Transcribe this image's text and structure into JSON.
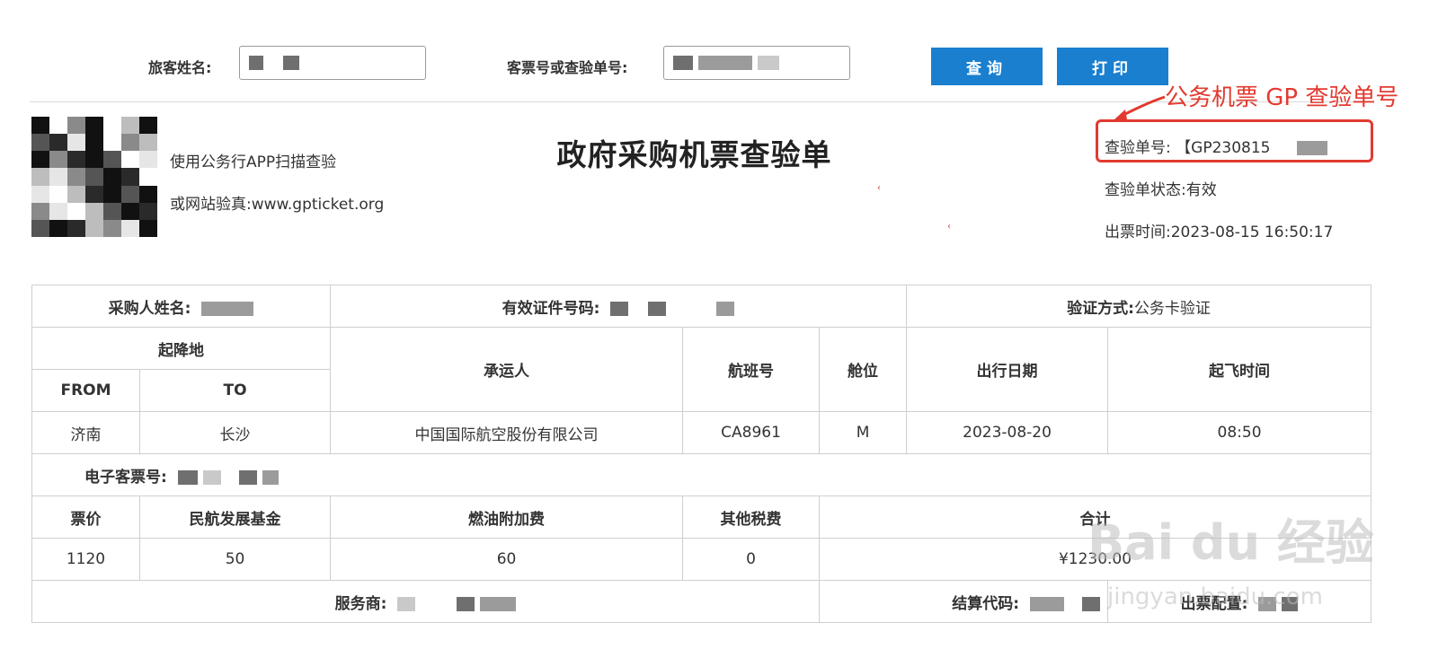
{
  "search": {
    "passenger_name_label": "旅客姓名:",
    "ticket_no_label": "客票号或查验单号:",
    "query_button": "查询",
    "print_button": "打印"
  },
  "header": {
    "scan_hint": "使用公务行APP扫描查验",
    "web_hint": "或网站验真:www.gpticket.org",
    "title": "政府采购机票查验单",
    "check_no_label": "查验单号:",
    "check_no_value": "【GP230815",
    "status_label": "查验单状态:",
    "status_value": "有效",
    "issue_time_label": "出票时间:",
    "issue_time_value": "2023-08-15 16:50:17",
    "annotation": "公务机票 GP 查验单号"
  },
  "table": {
    "purchaser_label": "采购人姓名:",
    "id_label": "有效证件号码:",
    "verify_label": "验证方式:",
    "verify_value": "公务卡验证",
    "route_header": "起降地",
    "from_header": "FROM",
    "to_header": "TO",
    "carrier_header": "承运人",
    "flight_header": "航班号",
    "cabin_header": "舱位",
    "date_header": "出行日期",
    "time_header": "起飞时间",
    "from_value": "济南",
    "to_value": "长沙",
    "carrier_value": "中国国际航空股份有限公司",
    "flight_value": "CA8961",
    "cabin_value": "M",
    "date_value": "2023-08-20",
    "time_value": "08:50",
    "eticket_label": "电子客票号:",
    "price_header": "票价",
    "fund_header": "民航发展基金",
    "fuel_header": "燃油附加费",
    "tax_header": "其他税费",
    "total_header": "合计",
    "price_value": "1120",
    "fund_value": "50",
    "fuel_value": "60",
    "tax_value": "0",
    "total_value": "¥1230.00",
    "provider_label": "服务商:",
    "settle_label": "结算代码:",
    "config_label": "出票配置:"
  },
  "watermark": {
    "main": "Bai du 经验",
    "sub": "jingyan.baidu.com"
  }
}
